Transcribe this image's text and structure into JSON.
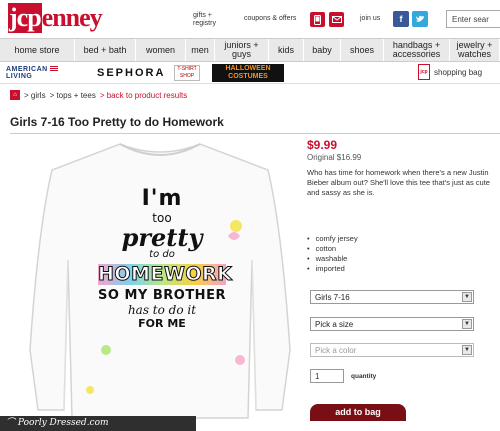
{
  "header": {
    "logo_box": "jcp",
    "logo_rest": "enney",
    "gifts_line1": "gifts +",
    "gifts_line2": "registry",
    "coupons": "coupons & offers",
    "join_us": "join us",
    "search_placeholder": "Enter sear"
  },
  "nav": {
    "items": [
      {
        "label": "home store",
        "w": 75
      },
      {
        "label": "bed + bath",
        "w": 61
      },
      {
        "label": "women",
        "w": 50
      },
      {
        "label": "men",
        "w": 29
      },
      {
        "label": "juniors + guys",
        "w": 54
      },
      {
        "label": "kids",
        "w": 35
      },
      {
        "label": "baby",
        "w": 37
      },
      {
        "label": "shoes",
        "w": 43
      },
      {
        "label": "handbags + accessories",
        "w": 66
      },
      {
        "label": "jewelry + watches",
        "w": 50
      }
    ]
  },
  "brands": {
    "american_living_1": "AMERICAN",
    "american_living_2": "LIVING",
    "sephora": "SEPHORA",
    "tshirt_shop": "T-SHIRT SHOP",
    "halloween_1": "HALLOWEEN",
    "halloween_2": "COSTUMES",
    "bag_icon": "jcp",
    "shopping_bag": "shopping bag"
  },
  "breadcrumb": {
    "home_icon": "⌂",
    "items": [
      "> girls",
      "> tops + tees",
      "> back to product results"
    ]
  },
  "product": {
    "title": "Girls 7-16 Too Pretty to do Homework",
    "price": "$9.99",
    "original_price": "Original $16.99",
    "description": "Who has time for homework when there's a new Justin Bieber album out? She'll love this tee that's just as cute and sassy as she is.",
    "features": [
      "comfy jersey",
      "cotton",
      "washable",
      "imported"
    ],
    "shirt_text": {
      "l1": "I'm",
      "l2": "too",
      "l3": "pretty",
      "l4": "to do",
      "l5": "HOMEWORK",
      "l6": "SO MY BROTHER",
      "l7": "has to do it",
      "l8": "FOR ME"
    }
  },
  "options": {
    "size_range": "Girls 7-16",
    "size": "Pick a size",
    "color": "Pick a color",
    "quantity_value": "1",
    "quantity_label": "quantity",
    "add_to_bag": "add to bag"
  },
  "watermark": {
    "text": "Poorly Dressed.com"
  },
  "colors": {
    "brand_red": "#c8102e",
    "add_to_bag": "#7a0e15",
    "nav_bg": "#e9e9e9"
  }
}
